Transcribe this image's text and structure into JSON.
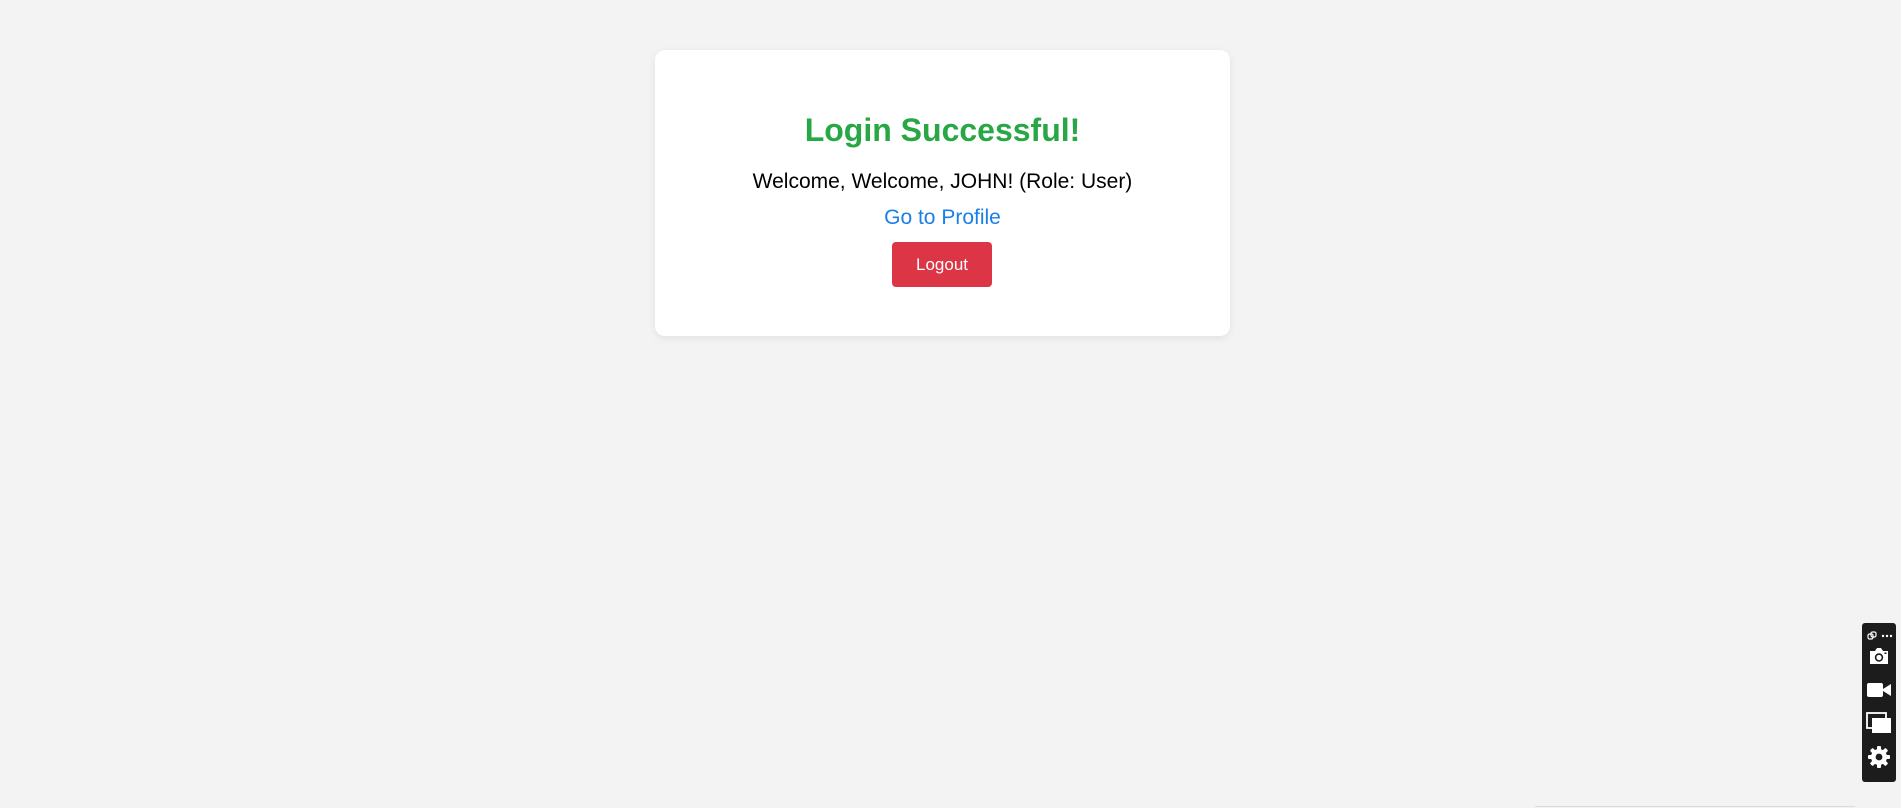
{
  "card": {
    "title": "Login Successful!",
    "welcome_text": "Welcome, Welcome, JOHN! (Role: User)",
    "profile_link": "Go to Profile",
    "logout_label": "Logout"
  },
  "colors": {
    "background": "#f3f3f3",
    "title": "#28a745",
    "link": "#1a7fe6",
    "logout_button": "#dc3545",
    "toolbar": "#1c1c1c"
  },
  "toolbar": {
    "icons": [
      "link-icon",
      "more-icon",
      "camera-icon",
      "video-camera-icon",
      "window-icon",
      "gear-icon"
    ]
  }
}
